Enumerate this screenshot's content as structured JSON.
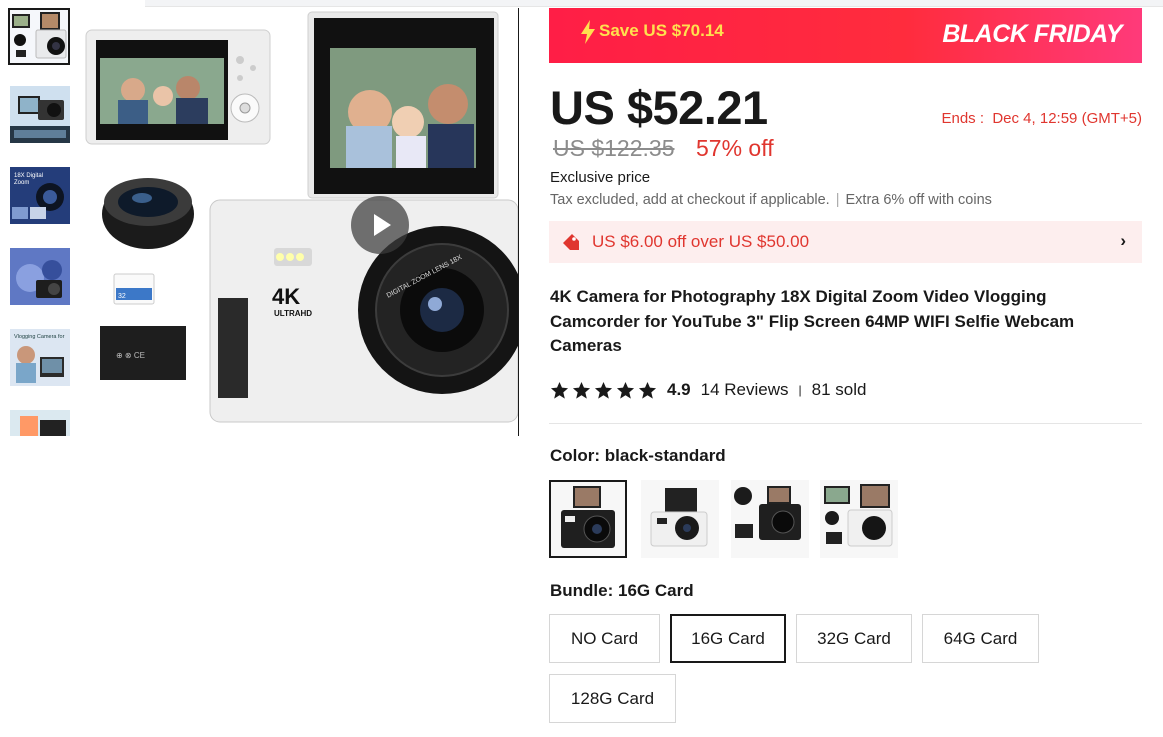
{
  "banner": {
    "save_text": "Save US $70.14",
    "promo_text": "BLACK FRIDAY",
    "colors": {
      "banner": "#ff2c3d",
      "save_text": "#ffe04f"
    }
  },
  "price": {
    "current": "US $52.21",
    "original": "US $122.35",
    "discount": "57% off",
    "ends_label": "Ends :",
    "ends_value": "Dec 4, 12:59 (GMT+5)",
    "exclusive": "Exclusive price",
    "tax_note": "Tax excluded, add at checkout if applicable.",
    "coins_note": "Extra 6% off with coins"
  },
  "coupon": {
    "text": "US $6.00 off over US $50.00",
    "chevron": "›"
  },
  "product": {
    "title": "4K Camera for Photography 18X Digital Zoom Video Vlogging Camcorder for YouTube 3\" Flip Screen 64MP WIFI Selfie Webcam Cameras"
  },
  "rating": {
    "score": "4.9",
    "stars": 5,
    "reviews": "14 Reviews",
    "sold": "81 sold"
  },
  "color": {
    "label": "Color: black-standard",
    "options": [
      {
        "icon": "camera-black-thumbnail"
      },
      {
        "icon": "camera-white-thumbnail"
      },
      {
        "icon": "camera-kit-black-thumbnail"
      },
      {
        "icon": "camera-kit-white-thumbnail"
      }
    ]
  },
  "bundle": {
    "label": "Bundle: 16G Card",
    "options": [
      "NO Card",
      "16G Card",
      "32G Card",
      "64G Card",
      "128G Card"
    ],
    "selected_index": 1
  },
  "gallery": {
    "main_image_text": {
      "badge": "4K",
      "sub": "ULTRAHD",
      "lens": "DIGITAL ZOOM LENS 18X"
    },
    "play_icon": "play-icon"
  },
  "colors": {
    "accent_red": "#e0362f",
    "text": "#191919"
  }
}
